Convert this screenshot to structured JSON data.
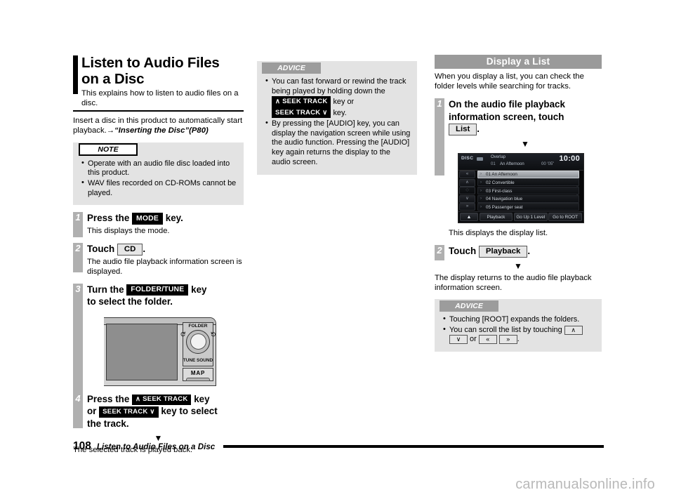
{
  "document": {
    "page_number": "108",
    "footer_title": "Listen to Audio Files on a Disc",
    "watermark": "carmanualsonline.info"
  },
  "left_column": {
    "title_line1": "Listen to Audio Files",
    "title_line2": "on a Disc",
    "subtitle": "This explains how to listen to audio files on a disc.",
    "intro_text": "Insert a disc in this product to automatically start playback.→",
    "intro_ref": "“Inserting the Disc”(P80)",
    "note_box": {
      "heading": "NOTE",
      "items": [
        "Operate with an audio file disc loaded into this product.",
        "WAV files recorded on CD-ROMs cannot be played."
      ]
    },
    "steps": [
      {
        "num": "1",
        "head_pre": "Press the",
        "key": "MODE",
        "head_post": "key.",
        "desc": "This displays the mode."
      },
      {
        "num": "2",
        "head_pre": "Touch",
        "key": "CD",
        "head_post": ".",
        "desc": "The audio file playback information screen is displayed."
      },
      {
        "num": "3",
        "head_pre": "Turn the",
        "key": "FOLDER/TUNE",
        "head_post": "key",
        "head_line2": "to select the folder.",
        "desc": ""
      },
      {
        "num": "4",
        "head_pre": "Press the",
        "key": "∧ SEEK TRACK",
        "head_post": "key",
        "head_or": "or",
        "key2": "SEEK TRACK ∨",
        "head_post2": "key to select",
        "head_line3": "the track.",
        "desc": ""
      }
    ],
    "arrow_glyph": "▼",
    "result_text": "The selected track is played back.",
    "head_unit": {
      "label_folder": "FOLDER",
      "label_tune_sound": "TUNE SOUND",
      "label_map": "MAP",
      "rotate_left_icon": "rotate-left-arrow",
      "rotate_right_icon": "rotate-right-arrow"
    }
  },
  "middle_column": {
    "advice_box": {
      "heading": "ADVICE",
      "item1_part1": "You can fast forward or rewind the track being played by holding down the",
      "item1_key1": "∧ SEEK TRACK",
      "item1_mid": "key or",
      "item1_key2": "SEEK TRACK ∨",
      "item1_part2": "key.",
      "item2": "By pressing the [AUDIO] key, you can display the navigation screen while using the audio function. Pressing the [AUDIO] key again returns the display to the audio screen."
    }
  },
  "right_column": {
    "section_title": "Display a List",
    "intro": "When you display a list, you can check the folder levels while searching for tracks.",
    "steps": [
      {
        "num": "1",
        "line1": "On the audio file playback",
        "line2": "information screen, touch",
        "key": "List",
        "after_key": ".",
        "desc": "This displays the display list."
      },
      {
        "num": "2",
        "head_pre": "Touch",
        "key": "Playback",
        "head_post": ".",
        "desc": ""
      }
    ],
    "arrow_glyph": "▼",
    "result_text": "The display returns to the audio file playback information screen.",
    "advice_box": {
      "heading": "ADVICE",
      "item1": "Touching [ROOT] expands the folders.",
      "item2_text": "You can scroll the list by touching",
      "item2_key1": "∧",
      "item2_key2": "∨",
      "item2_or": "or",
      "item2_key3": "«",
      "item2_key4": "»",
      "item2_end": "."
    },
    "device_screen": {
      "source_label": "DISC",
      "mode_label": "Overlap",
      "clock": "10:00",
      "now_playing_num": "01",
      "now_playing_title": "An Afternoon",
      "elapsed_time": "00 '05\"",
      "side_buttons": [
        {
          "icon": "scroll-top-icon",
          "glyph": "«",
          "dim": false
        },
        {
          "icon": "scroll-up-icon",
          "glyph": "∧",
          "dim": false
        },
        {
          "icon": "scroll-middle-icon",
          "glyph": "◇",
          "dim": true
        },
        {
          "icon": "scroll-down-icon",
          "glyph": "∨",
          "dim": false
        },
        {
          "icon": "scroll-bottom-icon",
          "glyph": "»",
          "dim": false
        }
      ],
      "rows": [
        {
          "num": "01",
          "name": "An Afternoon",
          "selected": true
        },
        {
          "num": "02",
          "name": "Convertible",
          "selected": false
        },
        {
          "num": "03",
          "name": "First-class",
          "selected": false
        },
        {
          "num": "04",
          "name": "Navigation blue",
          "selected": false
        },
        {
          "num": "05",
          "name": "Passenger seat",
          "selected": false
        }
      ],
      "bottom_buttons": [
        {
          "label": "▲",
          "name": "eject-button"
        },
        {
          "label": "Playback",
          "name": "playback-button"
        },
        {
          "label": "Go Up 1 Level",
          "name": "go-up-level-button"
        },
        {
          "label": "Go to ROOT",
          "name": "go-to-root-button"
        }
      ]
    }
  }
}
